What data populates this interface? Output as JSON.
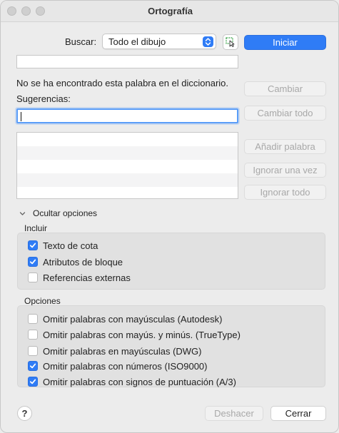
{
  "window": {
    "title": "Ortografía"
  },
  "search": {
    "label": "Buscar:",
    "scope": "Todo el dibujo",
    "start_label": "Iniciar"
  },
  "word_field": {
    "value": ""
  },
  "message": "No se ha encontrado esta palabra en el diccionario.",
  "suggestions": {
    "label": "Sugerencias:",
    "value": "",
    "items": [
      "",
      "",
      "",
      "",
      ""
    ]
  },
  "actions": {
    "change": "Cambiar",
    "change_all": "Cambiar todo",
    "add_word": "Añadir palabra",
    "ignore_once": "Ignorar una vez",
    "ignore_all": "Ignorar todo"
  },
  "options_toggle": "Ocultar opciones",
  "include": {
    "title": "Incluir",
    "items": [
      {
        "label": "Texto de cota",
        "checked": true
      },
      {
        "label": "Atributos de bloque",
        "checked": true
      },
      {
        "label": "Referencias externas",
        "checked": false
      }
    ]
  },
  "options": {
    "title": "Opciones",
    "items": [
      {
        "label": "Omitir palabras con mayúsculas (Autodesk)",
        "checked": false
      },
      {
        "label": "Omitir palabras con mayús. y minús. (TrueType)",
        "checked": false
      },
      {
        "label": "Omitir palabras en mayúsculas (DWG)",
        "checked": false
      },
      {
        "label": "Omitir palabras con números (ISO9000)",
        "checked": true
      },
      {
        "label": "Omitir palabras con signos de puntuación (A/3)",
        "checked": true
      }
    ]
  },
  "footer": {
    "help": "?",
    "undo": "Deshacer",
    "close": "Cerrar"
  },
  "colors": {
    "accent": "#2f7cf6",
    "disabled_text": "#a8a8a8"
  }
}
